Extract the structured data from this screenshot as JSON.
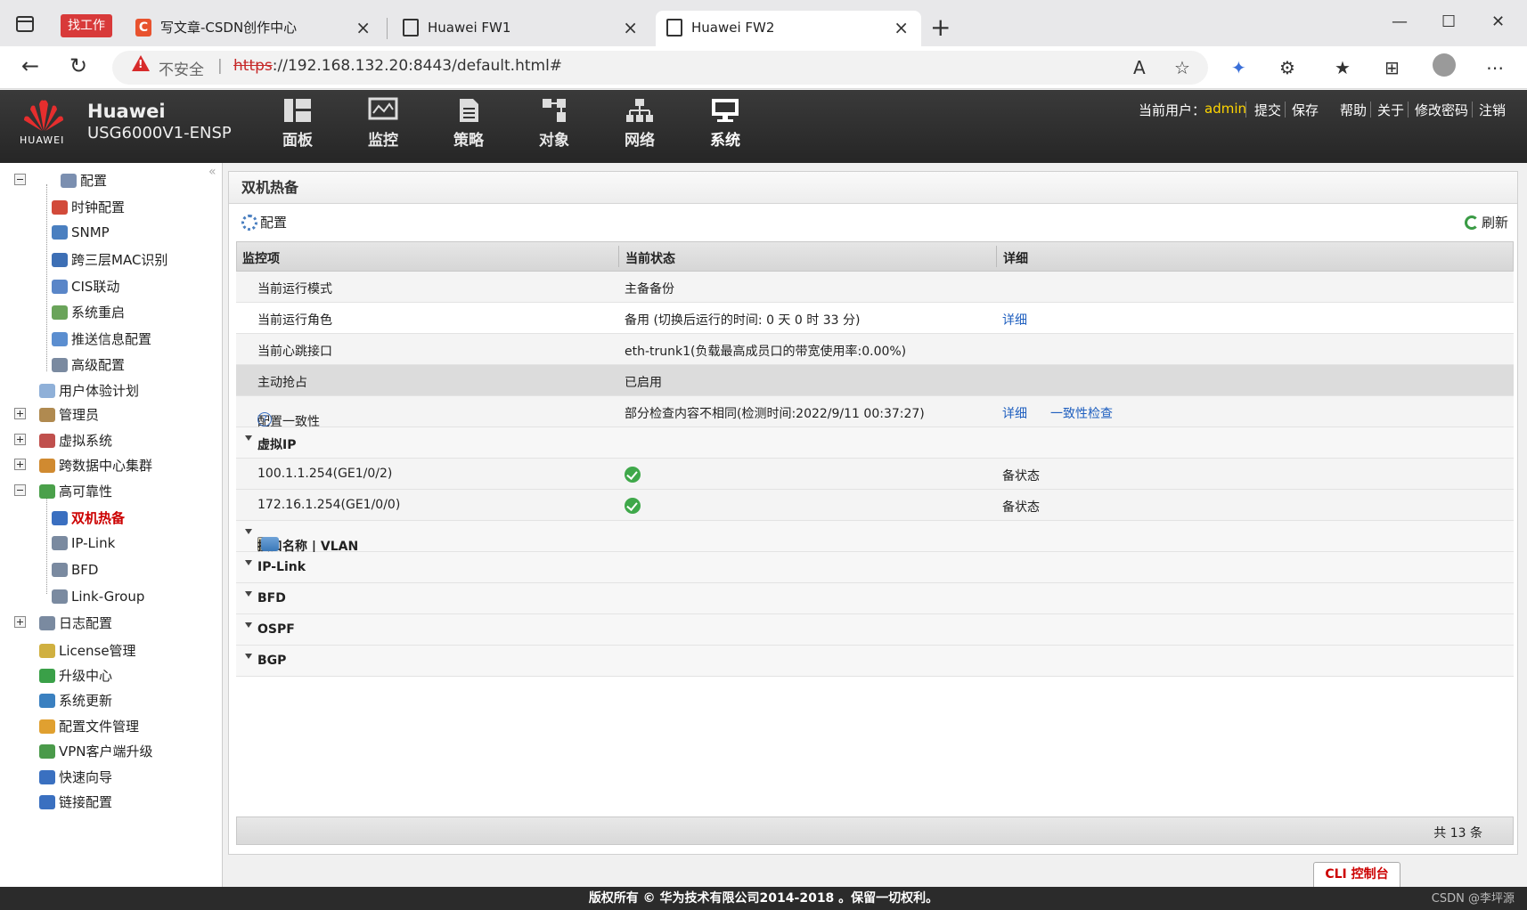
{
  "browser": {
    "work_badge": "找工作",
    "tabs": [
      {
        "title": "写文章-CSDN创作中心",
        "icon": "csdn-icon"
      },
      {
        "title": "Huawei FW1",
        "icon": "page-icon"
      },
      {
        "title": "Huawei FW2",
        "icon": "page-icon"
      }
    ],
    "insecure_label": "不安全",
    "url_scheme": "https",
    "url_rest": "://192.168.132.20:8443/default.html#"
  },
  "header": {
    "brand": "Huawei",
    "model": "USG6000V1-ENSP",
    "logo_text": "HUAWEI",
    "nav": [
      {
        "label": "面板",
        "icon": "dashboard-icon"
      },
      {
        "label": "监控",
        "icon": "monitor-icon"
      },
      {
        "label": "策略",
        "icon": "policy-icon"
      },
      {
        "label": "对象",
        "icon": "object-icon"
      },
      {
        "label": "网络",
        "icon": "network-icon"
      },
      {
        "label": "系统",
        "icon": "system-icon"
      }
    ],
    "user_label": "当前用户：",
    "user_name": "admin",
    "links": [
      "提交",
      "保存",
      "帮助",
      "关于",
      "修改密码",
      "注销"
    ]
  },
  "sidebar": {
    "items": [
      {
        "label": "配置",
        "icon": "config-icon",
        "color": "#7b8fb0"
      },
      {
        "label": "时钟配置",
        "icon": "clock-icon",
        "color": "#d24a3a"
      },
      {
        "label": "SNMP",
        "icon": "snmp-icon",
        "color": "#4a7fc0"
      },
      {
        "label": "跨三层MAC识别",
        "icon": "mac-icon",
        "color": "#3d6fb5"
      },
      {
        "label": "CIS联动",
        "icon": "cis-icon",
        "color": "#5a86c8"
      },
      {
        "label": "系统重启",
        "icon": "restart-icon",
        "color": "#6aa45a"
      },
      {
        "label": "推送信息配置",
        "icon": "push-icon",
        "color": "#5b8ed0"
      },
      {
        "label": "高级配置",
        "icon": "advanced-icon",
        "color": "#7a8aa0"
      },
      {
        "label": "用户体验计划",
        "icon": "user-exp-icon",
        "color": "#8fb0d8"
      },
      {
        "label": "管理员",
        "icon": "admin-icon",
        "color": "#b08a50"
      },
      {
        "label": "虚拟系统",
        "icon": "vsys-icon",
        "color": "#c0504d"
      },
      {
        "label": "跨数据中心集群",
        "icon": "cluster-icon",
        "color": "#d08a30"
      },
      {
        "label": "高可靠性",
        "icon": "reliability-icon",
        "color": "#4aa04a"
      },
      {
        "label": "双机热备",
        "icon": "hrp-icon",
        "color": "#3a6fc0"
      },
      {
        "label": "IP-Link",
        "icon": "iplink-icon",
        "color": "#7a8aa0"
      },
      {
        "label": "BFD",
        "icon": "bfd-icon",
        "color": "#7a8aa0"
      },
      {
        "label": "Link-Group",
        "icon": "linkgroup-icon",
        "color": "#7a8aa0"
      },
      {
        "label": "日志配置",
        "icon": "log-icon",
        "color": "#7a8aa0"
      },
      {
        "label": "License管理",
        "icon": "license-icon",
        "color": "#d0b040"
      },
      {
        "label": "升级中心",
        "icon": "upgrade-icon",
        "color": "#3aa048"
      },
      {
        "label": "系统更新",
        "icon": "update-icon",
        "color": "#3a80c0"
      },
      {
        "label": "配置文件管理",
        "icon": "file-icon",
        "color": "#e0a030"
      },
      {
        "label": "VPN客户端升级",
        "icon": "vpn-icon",
        "color": "#4a9a4a"
      },
      {
        "label": "快速向导",
        "icon": "wizard-icon",
        "color": "#3a70c0"
      },
      {
        "label": "链接配置",
        "icon": "link-config-icon",
        "color": "#3a70c0"
      }
    ]
  },
  "main": {
    "title": "双机热备",
    "config_label": "配置",
    "refresh_label": "刷新",
    "columns": [
      "监控项",
      "当前状态",
      "详细"
    ],
    "rows": [
      {
        "item": "当前运行模式",
        "status": "主备备份",
        "detail": ""
      },
      {
        "item": "当前运行角色",
        "status": "备用 (切换后运行的时间: 0 天 0 时 33 分)",
        "detail": "详细"
      },
      {
        "item": "当前心跳接口",
        "status": "eth-trunk1(负载最高成员口的带宽使用率:0.00%)",
        "detail": ""
      },
      {
        "item": "主动抢占",
        "status": "已启用",
        "detail": ""
      },
      {
        "item": "配置一致性",
        "status": "部分检查内容不相同(检测时间:2022/9/11 00:37:27)",
        "detail": "详细",
        "detail2": "一致性检查"
      }
    ],
    "vip_group": "虚拟IP",
    "vip_rows": [
      {
        "item": "100.1.1.254(GE1/0/2)",
        "state": "备状态"
      },
      {
        "item": "172.16.1.254(GE1/0/0)",
        "state": "备状态"
      }
    ],
    "groups": [
      "接口名称 | VLAN",
      "IP-Link",
      "BFD",
      "OSPF",
      "BGP"
    ],
    "total": "共 13 条"
  },
  "cli_label": "CLI 控制台",
  "copyright": "版权所有 © 华为技术有限公司2014-2018 。保留一切权利。",
  "watermark": "CSDN @李坪源"
}
